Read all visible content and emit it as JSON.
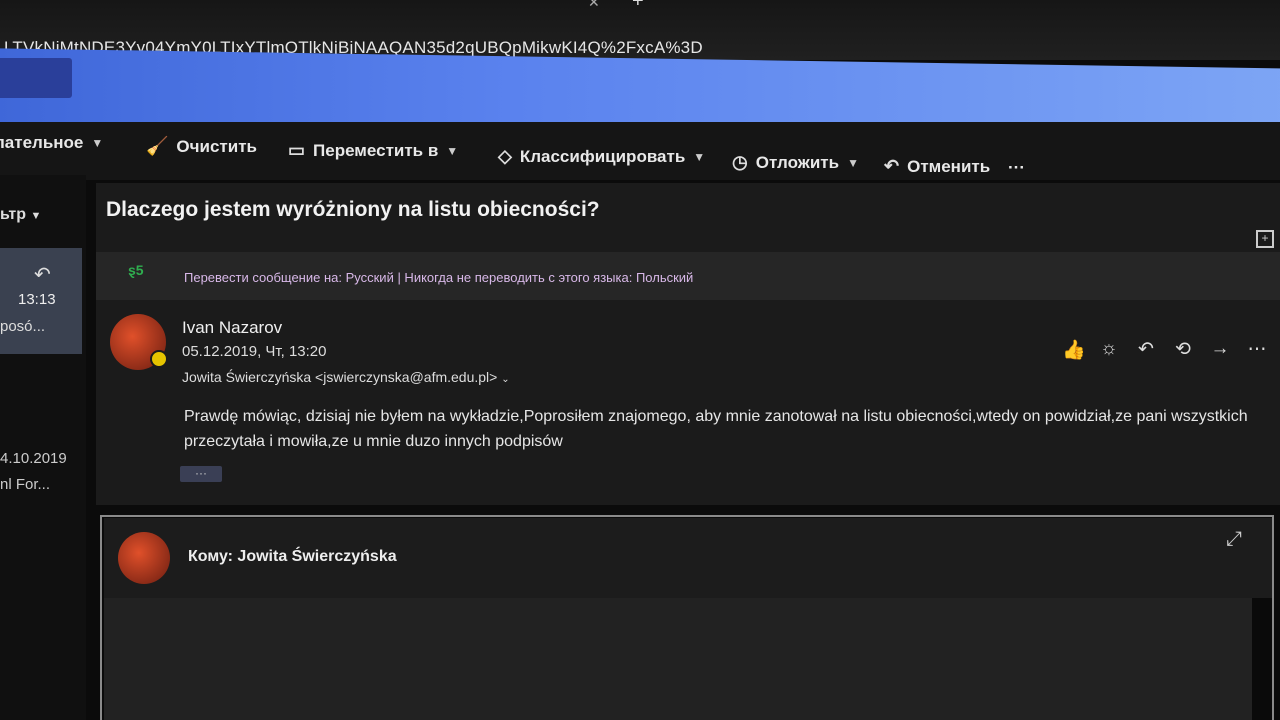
{
  "browser": {
    "url": "LTVkNjMtNDE3Yy04YmY0LTIxYTlmOTlkNjBjNAAQAN35d2qUBQpMikwKI4Q%2FxcA%3D"
  },
  "toolbar": {
    "items": [
      {
        "label": "лательное",
        "icon": "chevron-down"
      },
      {
        "label": "Очистить",
        "icon": "broom-icon"
      },
      {
        "label": "Переместить в",
        "icon": "folder-move-icon"
      },
      {
        "label": "Классифицировать",
        "icon": "tag-icon"
      },
      {
        "label": "Отложить",
        "icon": "clock-icon"
      },
      {
        "label": "Отменить",
        "icon": "undo-icon"
      }
    ],
    "more": "···"
  },
  "sidebar": {
    "filter_label": "ьтр",
    "selected_item": {
      "time": "13:13",
      "preview": "posó..."
    },
    "other_item": {
      "date": "4.10.2019",
      "preview": "nl For..."
    }
  },
  "message": {
    "subject": "Dlaczego jestem wyróżniony na listu obiecności?",
    "translate_text": "Перевести сообщение на: Русский | Никогда не переводить с этого языка: Польский",
    "sender": "Ivan Nazarov",
    "date": "05.12.2019, Чт, 13:20",
    "recipient": "Jowita Świerczyńska <jswierczynska@afm.edu.pl>",
    "body": "Prawdę mówiąc, dzisiaj nie byłem na wykładzie,Poprosiłem znajomego, aby mnie zanotował na listu obiecności,wtedy on powidział,ze pani wszystkich przeczytała  i mowiła,ze u mnie duzo innych podpisów",
    "ellipsis": "···"
  },
  "compose": {
    "to_label": "Кому:",
    "to_name": "Jowita Świerczyńska"
  }
}
